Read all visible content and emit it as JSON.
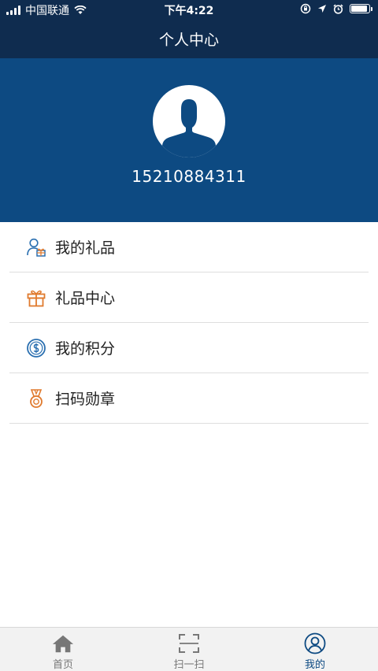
{
  "status_bar": {
    "carrier": "中国联通",
    "time": "下午4:22"
  },
  "nav": {
    "title": "个人中心"
  },
  "profile": {
    "phone": "15210884311"
  },
  "menu": {
    "items": [
      {
        "label": "我的礼品",
        "icon": "user-gift-icon"
      },
      {
        "label": "礼品中心",
        "icon": "gift-box-icon"
      },
      {
        "label": "我的积分",
        "icon": "dollar-coin-icon"
      },
      {
        "label": "扫码勋章",
        "icon": "medal-icon"
      }
    ]
  },
  "tabs": {
    "items": [
      {
        "label": "首页",
        "icon": "home-icon"
      },
      {
        "label": "扫一扫",
        "icon": "scan-icon"
      },
      {
        "label": "我的",
        "icon": "profile-icon",
        "active": true
      }
    ]
  },
  "colors": {
    "nav_bg": "#0f2c4f",
    "header_bg": "#0d4a82",
    "accent_orange": "#e07a2e",
    "accent_blue": "#2a6fb0"
  }
}
